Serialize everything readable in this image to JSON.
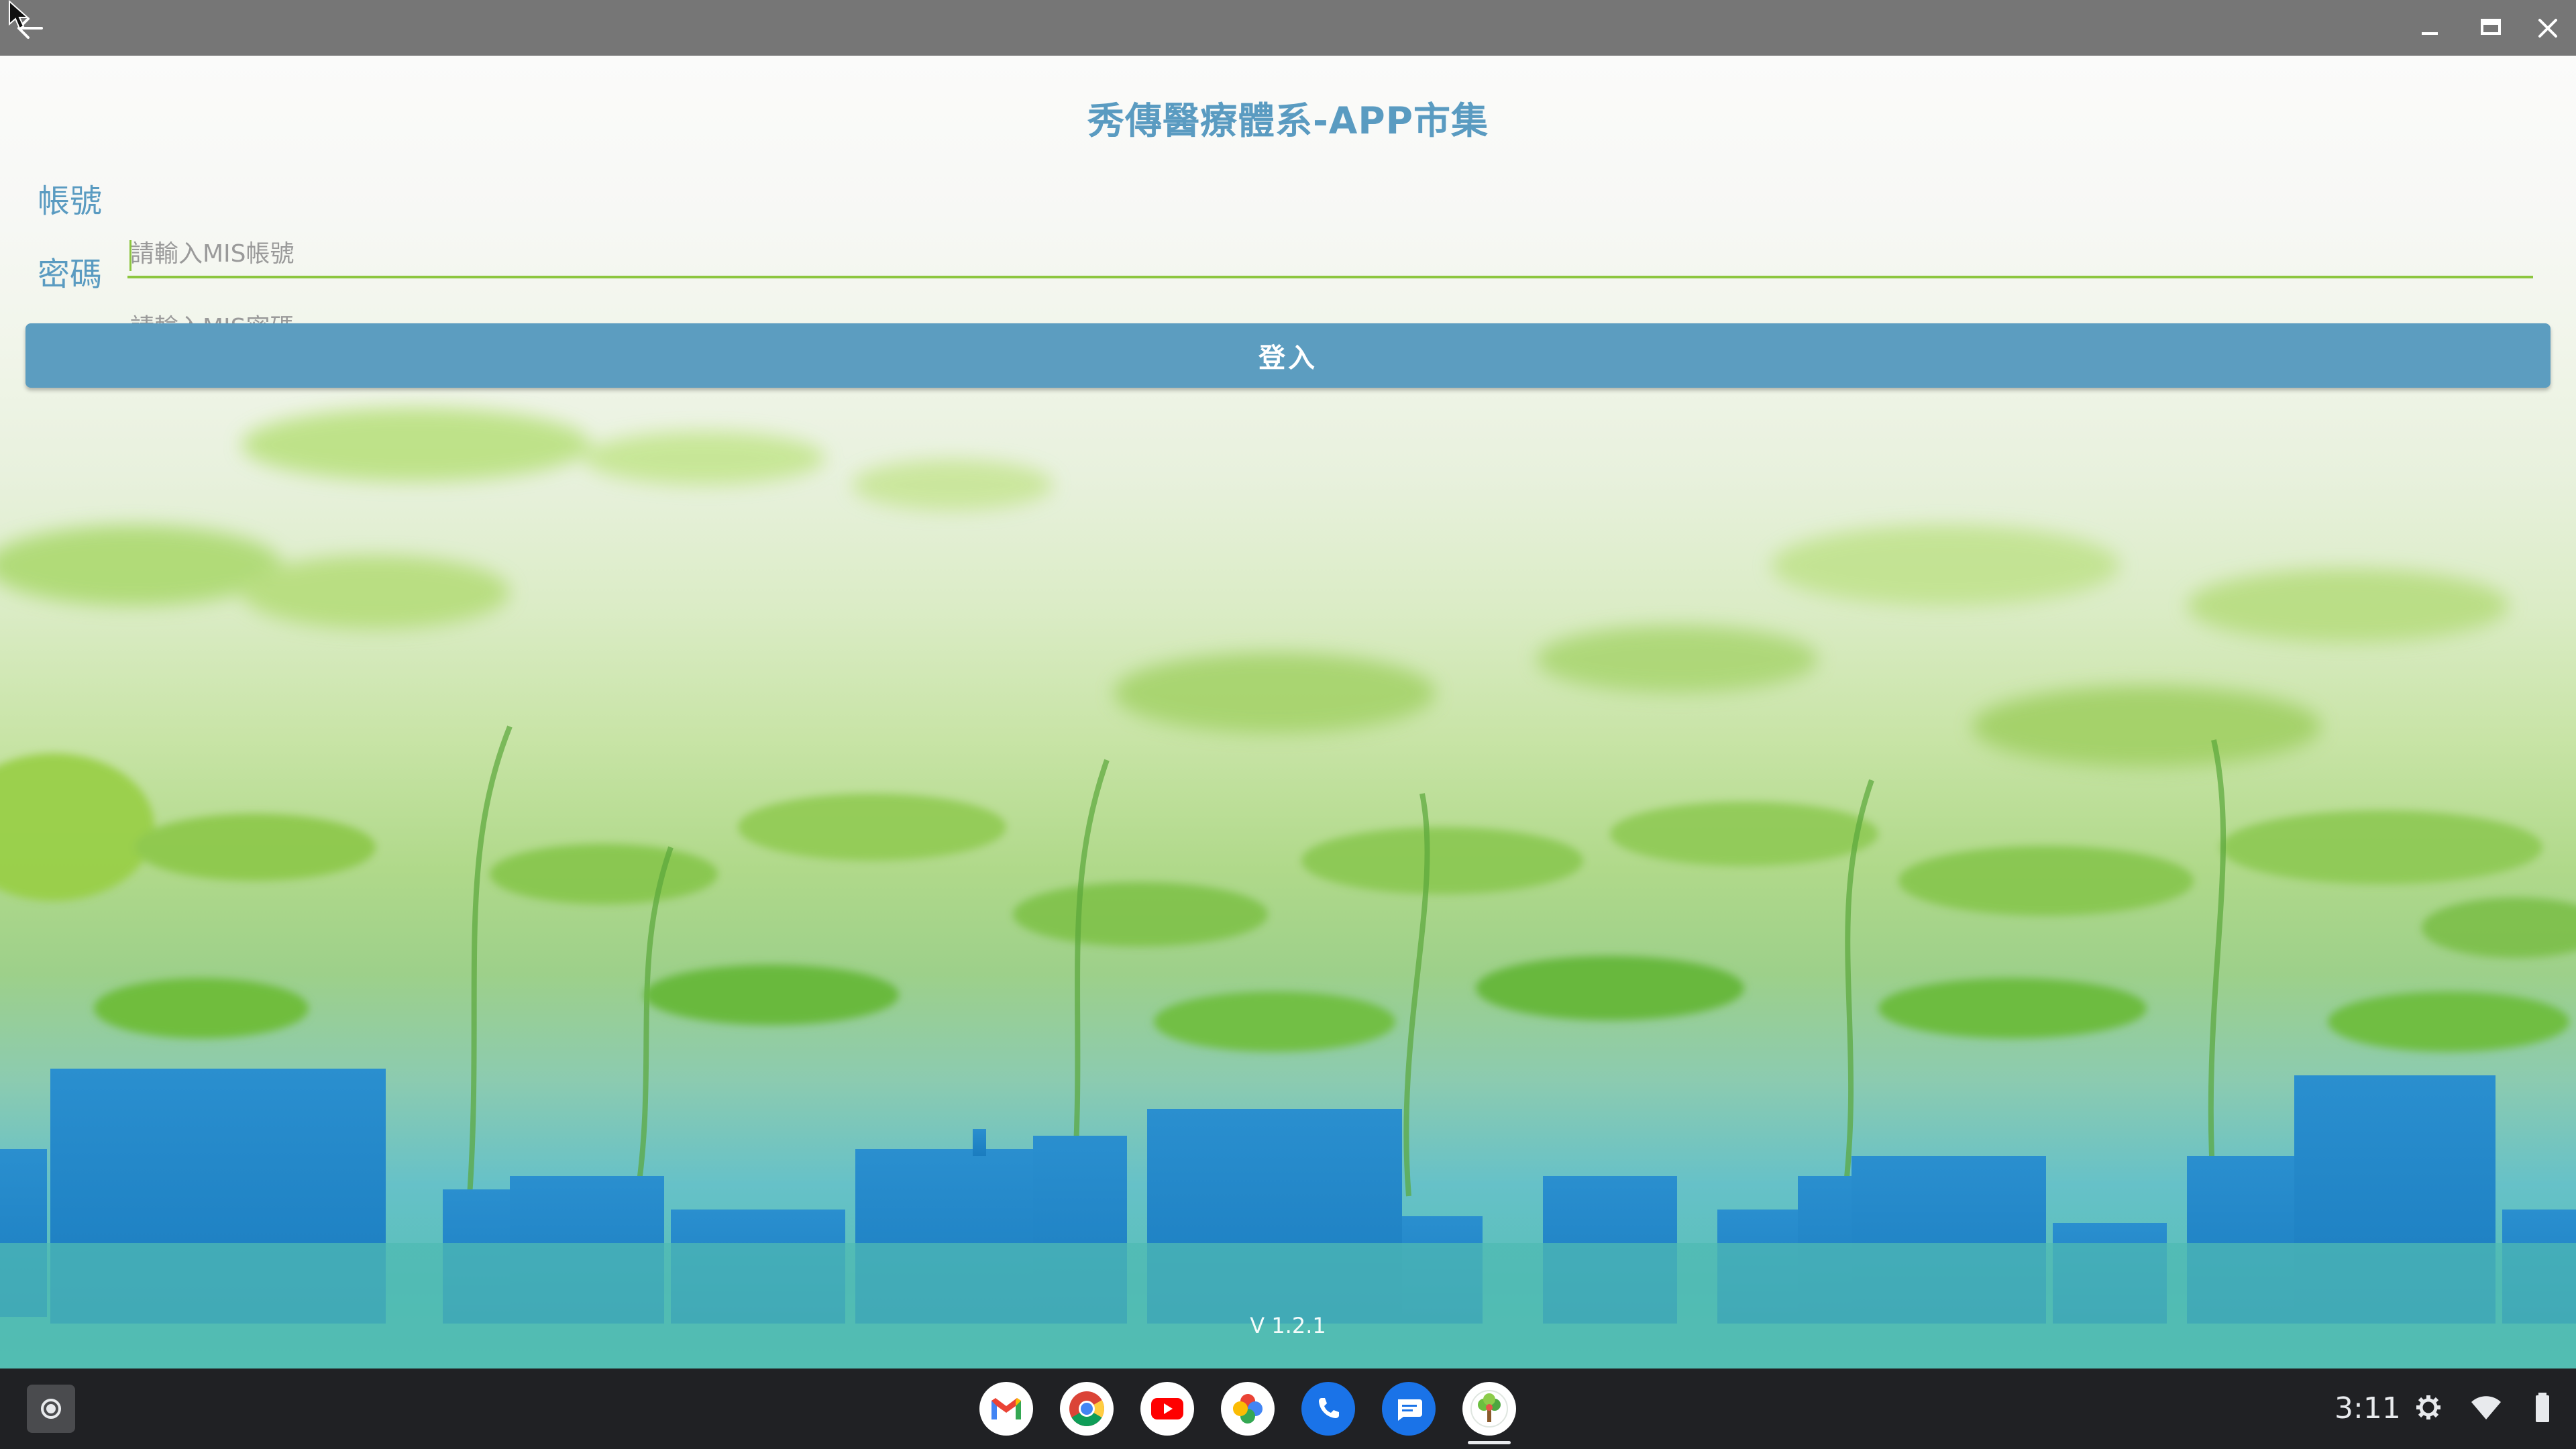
{
  "app": {
    "title": "秀傳醫療體系-APP市集",
    "version": "V 1.2.1"
  },
  "form": {
    "account_label": "帳號",
    "account_placeholder": "請輸入MIS帳號",
    "account_value": "",
    "password_label": "密碼",
    "password_placeholder": "請輸入MIS密碼",
    "password_value": "",
    "login_label": "登入"
  },
  "window": {
    "controls": [
      "back-icon",
      "minimize-icon",
      "maximize-icon",
      "close-icon"
    ]
  },
  "shelf": {
    "launcher_icon": "launcher-icon",
    "apps": [
      "gmail-icon",
      "chrome-icon",
      "youtube-icon",
      "photos-icon",
      "phone-icon",
      "messages-icon",
      "app-market-icon"
    ],
    "active_app": "app-market-icon",
    "clock": "3:11",
    "tray_icons": [
      "settings-icon",
      "wifi-icon",
      "battery-icon"
    ]
  },
  "colors": {
    "accent": "#5a9bc1",
    "button": "#5c9dc0",
    "focus_underline": "#8cc63f",
    "titlebar": "#767676",
    "shelf": "#202124"
  }
}
